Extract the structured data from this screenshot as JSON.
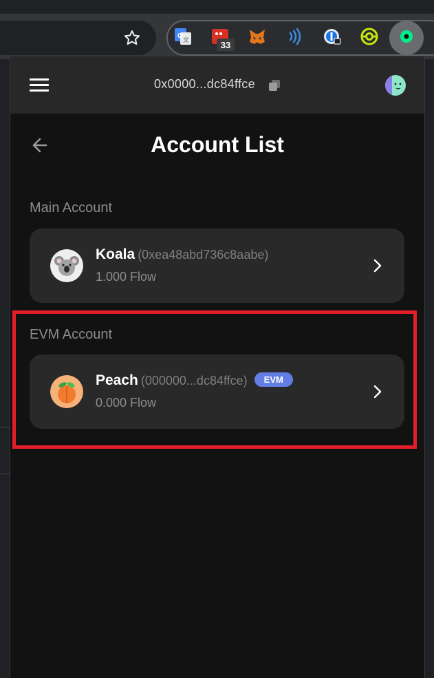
{
  "browser": {
    "extension_badge": "33",
    "icons": [
      "bookmark-star-icon",
      "google-translate-icon",
      "calendar-extension-icon",
      "metamask-fox-icon",
      "nfc-extension-icon",
      "password-manager-icon",
      "camera-extension-icon",
      "flow-wallet-icon"
    ]
  },
  "wallet": {
    "header_address": "0x0000...dc84ffce",
    "title": "Account List",
    "main_section_label": "Main Account",
    "evm_section_label": "EVM Account",
    "accounts": [
      {
        "name": "Koala",
        "address": "(0xea48abd736c8aabe)",
        "balance": "1.000 Flow",
        "avatar": "koala-avatar"
      },
      {
        "name": "Peach",
        "address": "(000000...dc84ffce)",
        "balance": "0.000 Flow",
        "badge": "EVM",
        "avatar": "peach-avatar"
      }
    ]
  },
  "colors": {
    "popup_bg": "#121212",
    "card_bg": "#292929",
    "evm_badge": "#627ee4",
    "highlight": "#e21e2a"
  }
}
